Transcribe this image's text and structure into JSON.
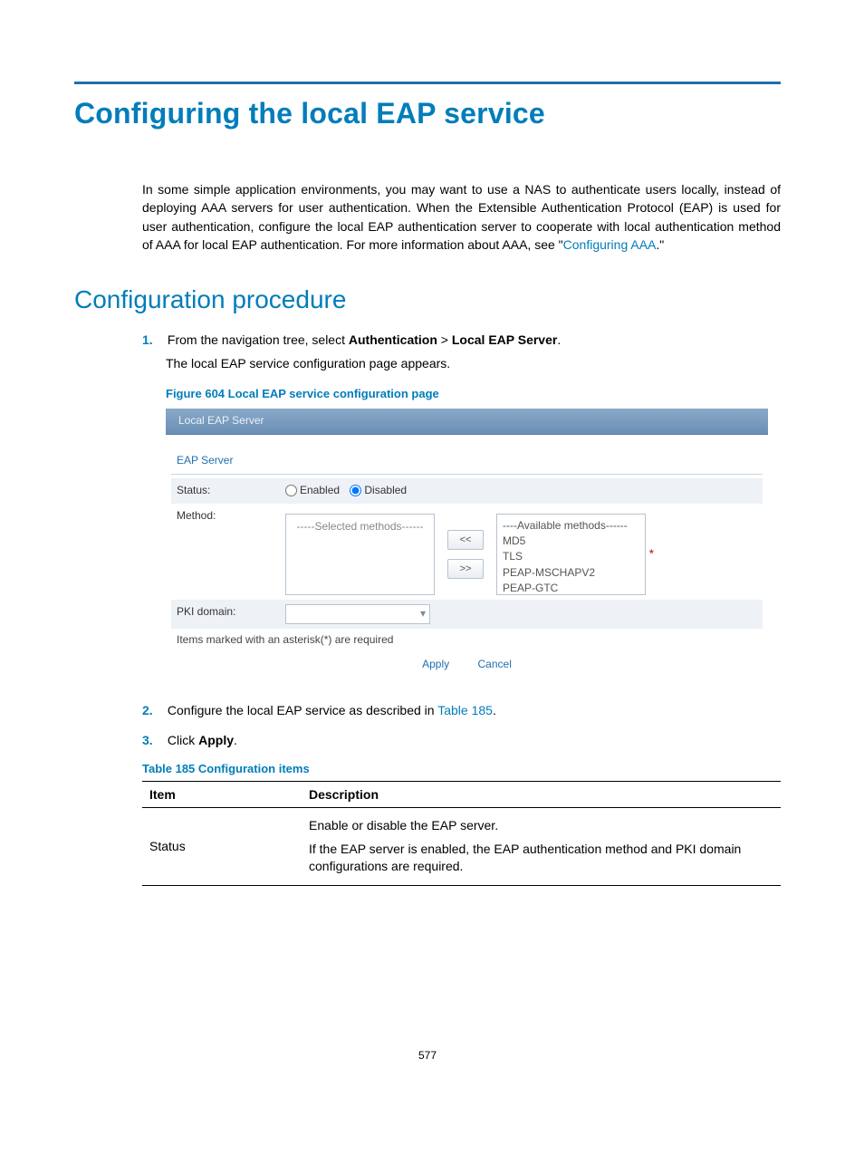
{
  "title": "Configuring the local EAP service",
  "intro": {
    "text": "In some simple application environments, you may want to use a NAS to authenticate users locally, instead of deploying AAA servers for user authentication. When the Extensible Authentication Protocol (EAP) is used for user authentication, configure the local EAP authentication server to cooperate with local authentication method of AAA for local EAP authentication. For more information about AAA, see \"",
    "link": "Configuring AAA",
    "after": ".\""
  },
  "section": "Configuration procedure",
  "steps": {
    "items": [
      {
        "num": "1.",
        "pre": "From the navigation tree, select ",
        "b1": "Authentication",
        "sep": " > ",
        "b2": "Local EAP Server",
        "post": ".",
        "rest": "The local EAP service configuration page appears."
      },
      {
        "num": "2.",
        "pre": "Configure the local EAP service as described in ",
        "link": "Table 185",
        "post": "."
      },
      {
        "num": "3.",
        "pre": "Click ",
        "b1": "Apply",
        "post": "."
      }
    ]
  },
  "figure": {
    "caption": "Figure 604 Local EAP service configuration page"
  },
  "screenshot": {
    "tab": "Local EAP Server",
    "section_label": "EAP Server",
    "labels": {
      "status": "Status:",
      "method": "Method:",
      "pki": "PKI domain:"
    },
    "status": {
      "enabled": "Enabled",
      "disabled": "Disabled",
      "selected": "disabled"
    },
    "method": {
      "selected_header": "-----Selected methods------",
      "available_header": "----Available methods------",
      "available": [
        "MD5",
        "TLS",
        "PEAP-MSCHAPV2",
        "PEAP-GTC"
      ],
      "move_left": "<<",
      "move_right": ">>"
    },
    "req_star": "*",
    "req_note": "Items marked with an asterisk(*) are required",
    "actions": {
      "apply": "Apply",
      "cancel": "Cancel"
    }
  },
  "table": {
    "caption": "Table 185 Configuration items",
    "headers": {
      "item": "Item",
      "desc": "Description"
    },
    "rows": [
      {
        "item": "Status",
        "desc1": "Enable or disable the EAP server.",
        "desc2": "If the EAP server is enabled, the EAP authentication method and PKI domain configurations are required."
      }
    ]
  },
  "page_number": "577"
}
